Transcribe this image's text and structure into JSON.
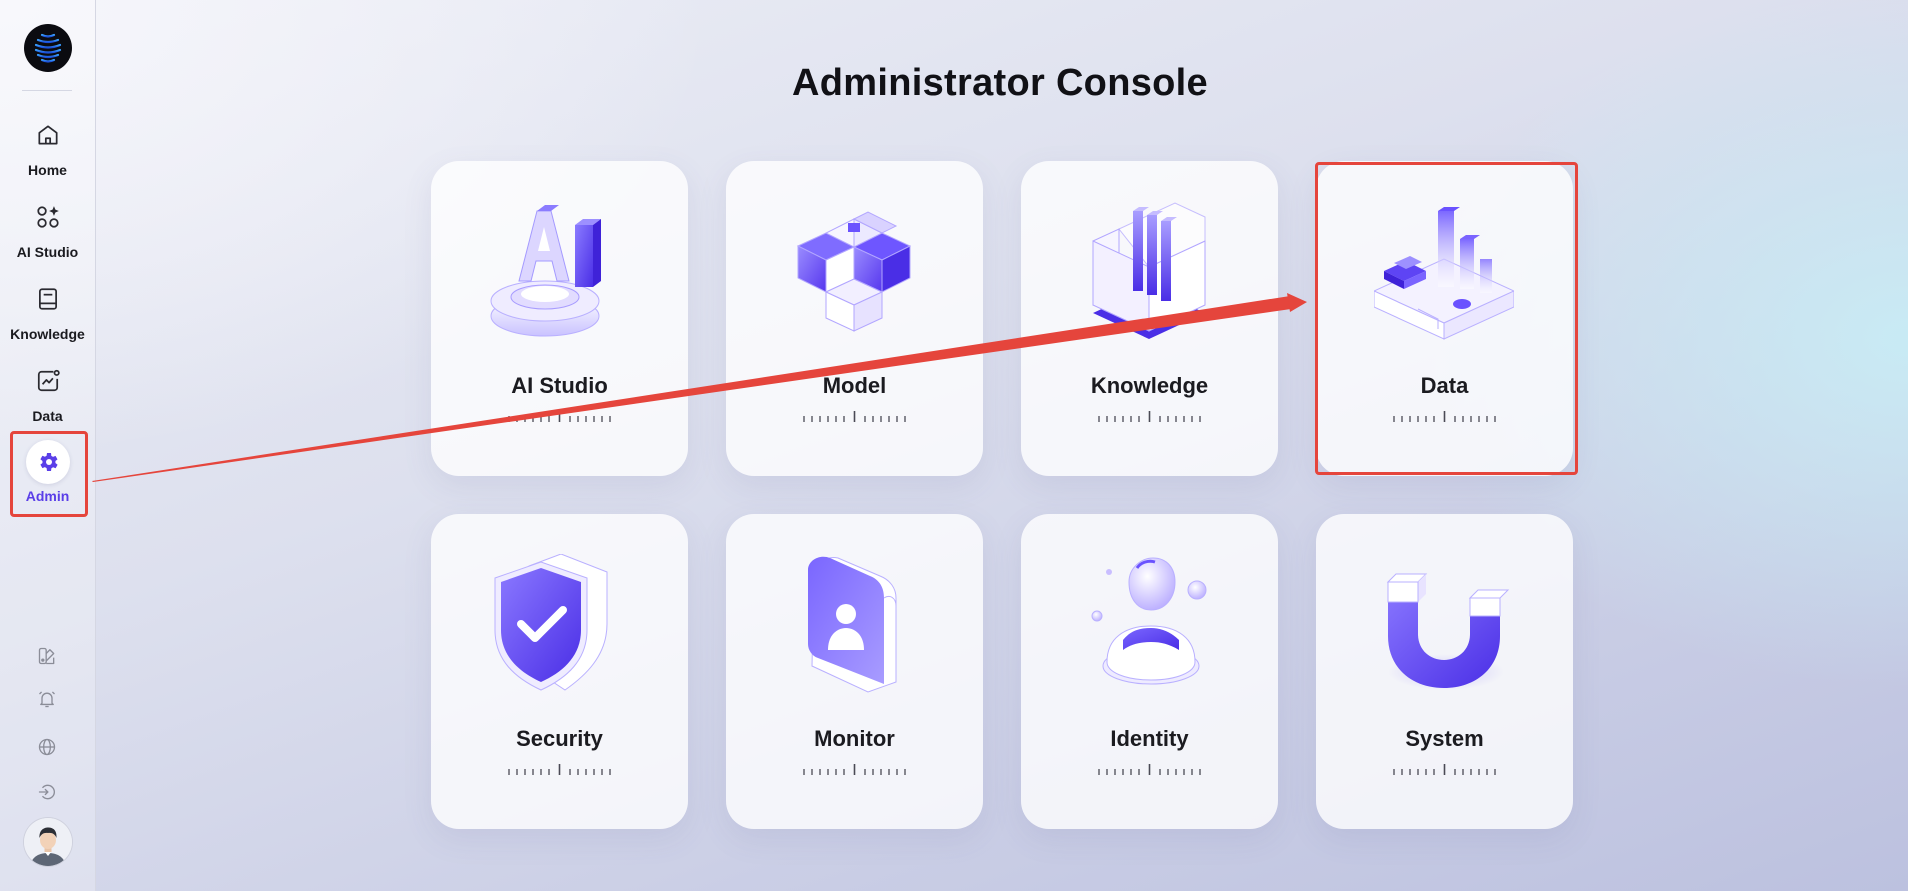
{
  "sidebar": {
    "logo_icon": "waveform-logo-icon",
    "items": [
      {
        "label": "Home",
        "icon": "home-icon"
      },
      {
        "label": "AI Studio",
        "icon": "apps-sparkle-icon"
      },
      {
        "label": "Knowledge",
        "icon": "book-icon"
      },
      {
        "label": "Data",
        "icon": "chart-icon"
      },
      {
        "label": "Admin",
        "icon": "gear-icon",
        "active": true
      }
    ],
    "utilities": [
      "theme-palette-icon",
      "notification-bell-icon",
      "language-globe-icon",
      "logout-icon"
    ],
    "avatar_icon": "user-avatar-icon"
  },
  "main": {
    "title": "Administrator Console",
    "cards": [
      {
        "label": "AI Studio",
        "icon": "ai-studio-3d-icon"
      },
      {
        "label": "Model",
        "icon": "model-cubes-3d-icon"
      },
      {
        "label": "Knowledge",
        "icon": "knowledge-books-3d-icon"
      },
      {
        "label": "Data",
        "icon": "data-chart-3d-icon",
        "highlighted": true
      },
      {
        "label": "Security",
        "icon": "security-shield-3d-icon"
      },
      {
        "label": "Monitor",
        "icon": "monitor-badge-3d-icon"
      },
      {
        "label": "Identity",
        "icon": "identity-user-3d-icon"
      },
      {
        "label": "System",
        "icon": "system-magnet-3d-icon"
      }
    ]
  },
  "colors": {
    "accent": "#5a3ee8",
    "annotation": "#e5453c",
    "icon_purple": "#6b54f5"
  }
}
